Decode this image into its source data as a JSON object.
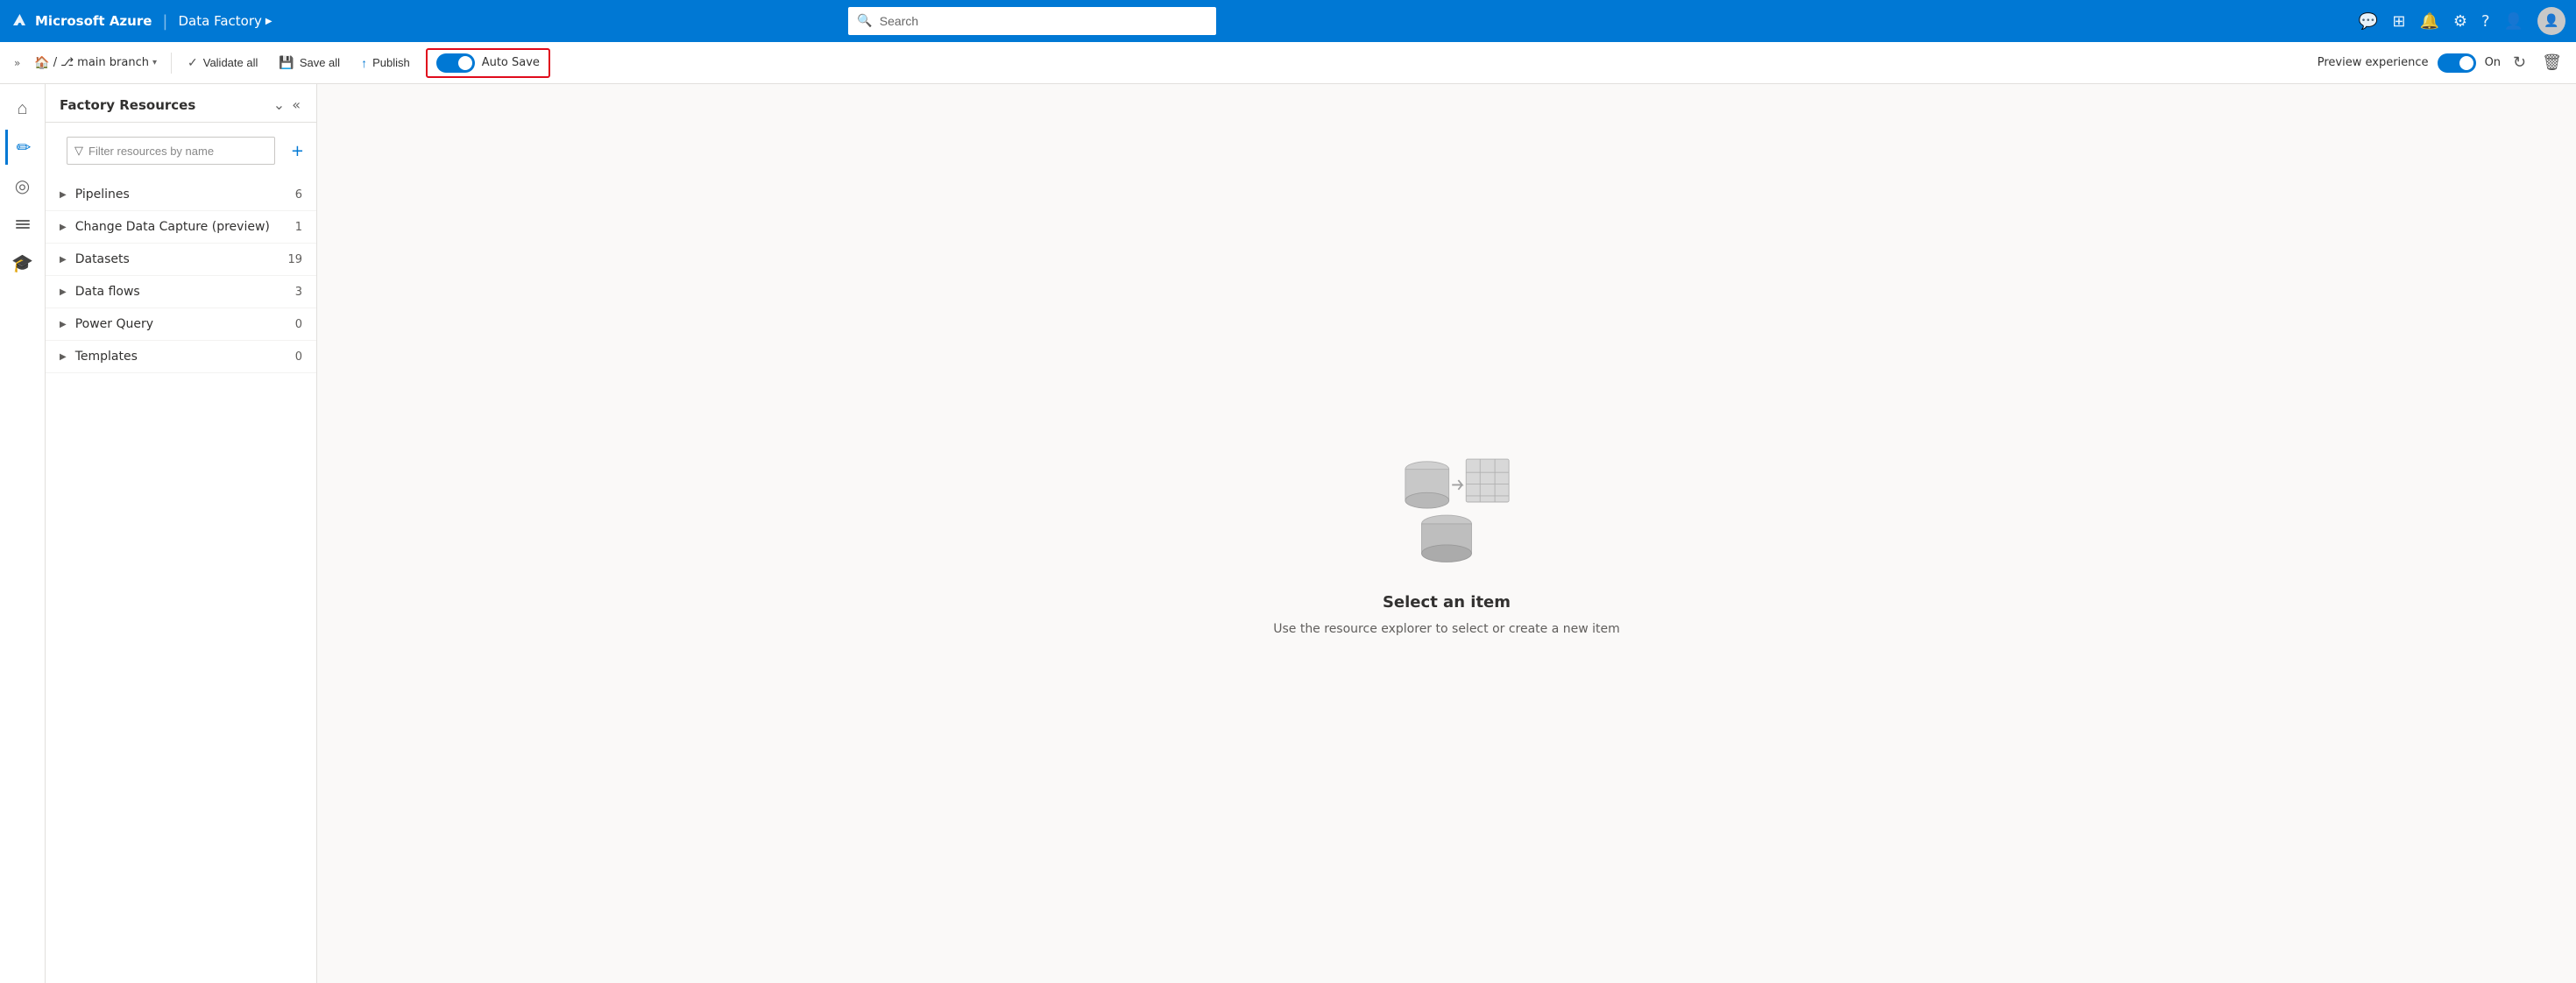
{
  "topNav": {
    "brand": "Microsoft Azure",
    "separator": "|",
    "appName": "Data Factory",
    "chevron": "▶",
    "search": {
      "placeholder": "Search"
    },
    "icons": [
      "📺",
      "⊞",
      "🔔",
      "⚙",
      "?",
      "👤"
    ]
  },
  "toolbar": {
    "collapseIcon": "«",
    "branchIcon": "↩",
    "branchSeparator": "/",
    "gitIcon": "⎇",
    "branchName": "main branch",
    "branchChevron": "▾",
    "validateAll": "Validate all",
    "saveAll": "Save all",
    "publish": "Publish",
    "autoSave": "Auto Save",
    "previewExperience": "Preview experience",
    "previewOn": "On"
  },
  "sidebar": {
    "items": [
      {
        "id": "home",
        "icon": "⌂",
        "active": false
      },
      {
        "id": "edit",
        "icon": "✏",
        "active": true
      },
      {
        "id": "monitor",
        "icon": "◎",
        "active": false
      },
      {
        "id": "manage",
        "icon": "💼",
        "active": false
      },
      {
        "id": "learn",
        "icon": "🎓",
        "active": false
      }
    ]
  },
  "resourcesPanel": {
    "title": "Factory Resources",
    "collapseIcon": "⌄",
    "collapseLeft": "«",
    "searchPlaceholder": "Filter resources by name",
    "addIcon": "+",
    "items": [
      {
        "name": "Pipelines",
        "count": 6
      },
      {
        "name": "Change Data Capture (preview)",
        "count": 1
      },
      {
        "name": "Datasets",
        "count": 19
      },
      {
        "name": "Data flows",
        "count": 3
      },
      {
        "name": "Power Query",
        "count": 0
      },
      {
        "name": "Templates",
        "count": 0
      }
    ]
  },
  "emptyState": {
    "title": "Select an item",
    "description": "Use the resource explorer to select or create a new item"
  }
}
